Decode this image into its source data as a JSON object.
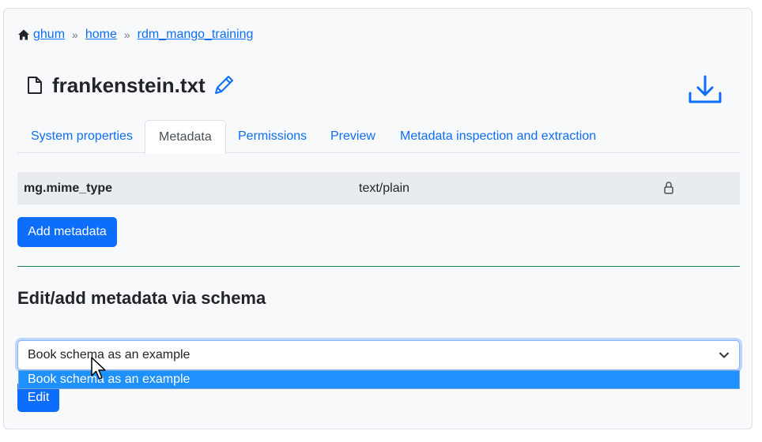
{
  "breadcrumb": {
    "home_icon": "home-icon",
    "items": [
      "ghum",
      "home",
      "rdm_mango_training"
    ],
    "separator": "»"
  },
  "file": {
    "icon": "file-icon",
    "name": "frankenstein.txt",
    "edit_icon": "pencil-icon",
    "download_icon": "download-icon"
  },
  "tabs": [
    {
      "label": "System properties",
      "active": false
    },
    {
      "label": "Metadata",
      "active": true
    },
    {
      "label": "Permissions",
      "active": false
    },
    {
      "label": "Preview",
      "active": false
    },
    {
      "label": "Metadata inspection and extraction",
      "active": false
    }
  ],
  "metadata": {
    "rows": [
      {
        "key": "mg.mime_type",
        "value": "text/plain",
        "icon": "lock-icon"
      }
    ]
  },
  "actions": {
    "add_metadata": "Add metadata",
    "edit": "Edit"
  },
  "schema": {
    "heading": "Edit/add metadata via schema",
    "selected": "Book schema as an example",
    "options": [
      "Book schema as an example"
    ]
  },
  "colors": {
    "primary": "#0d6efd",
    "divider": "#198754",
    "option_highlight": "#1e90ff"
  }
}
